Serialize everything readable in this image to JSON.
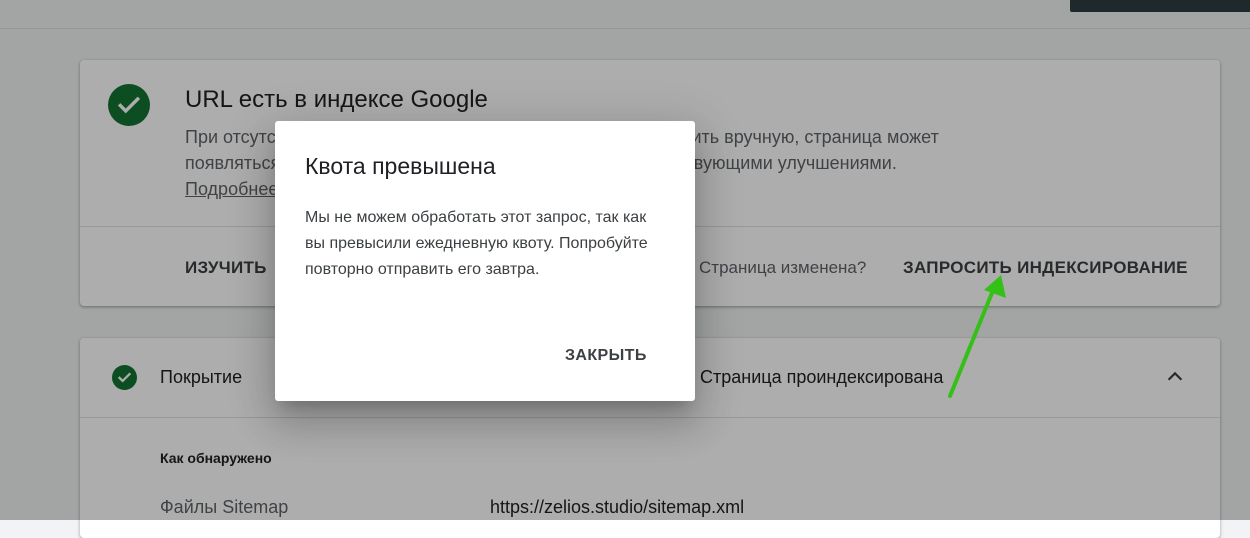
{
  "status_card": {
    "title": "URL есть в индексе Google",
    "description_line1": "При отсутствии проблем, перечисленных ниже, если проверить вручную, страница может",
    "description_line2": "появляться в результатах Google Поиска со всеми соответствующими улучшениями.",
    "learn_more": "Подробнее",
    "actions": {
      "explore": "ИЗУЧИТЬ",
      "page_changed": "Страница изменена?",
      "request_indexing": "ЗАПРОСИТЬ ИНДЕКСИРОВАНИЕ"
    }
  },
  "coverage_card": {
    "label": "Покрытие",
    "status": "Страница проиндексирована",
    "discovered_heading": "Как обнаружено",
    "sitemaps_label": "Файлы Sitemap",
    "sitemaps_value": "https://zelios.studio/sitemap.xml"
  },
  "dialog": {
    "title": "Квота превышена",
    "body": "Мы не можем обработать этот запрос, так как вы превысили ежедневную квоту. Попробуйте повторно отправить его завтра.",
    "close_button": "ЗАКРЫТЬ"
  },
  "colors": {
    "success_green": "#137333",
    "annotation_arrow": "#34c017",
    "scrim": "rgba(0,0,0,0.32)"
  },
  "icons": {
    "status": "check-circle-icon",
    "coverage": "check-circle-icon",
    "expand": "chevron-up-icon",
    "annotation": "arrow-annotation-icon"
  }
}
